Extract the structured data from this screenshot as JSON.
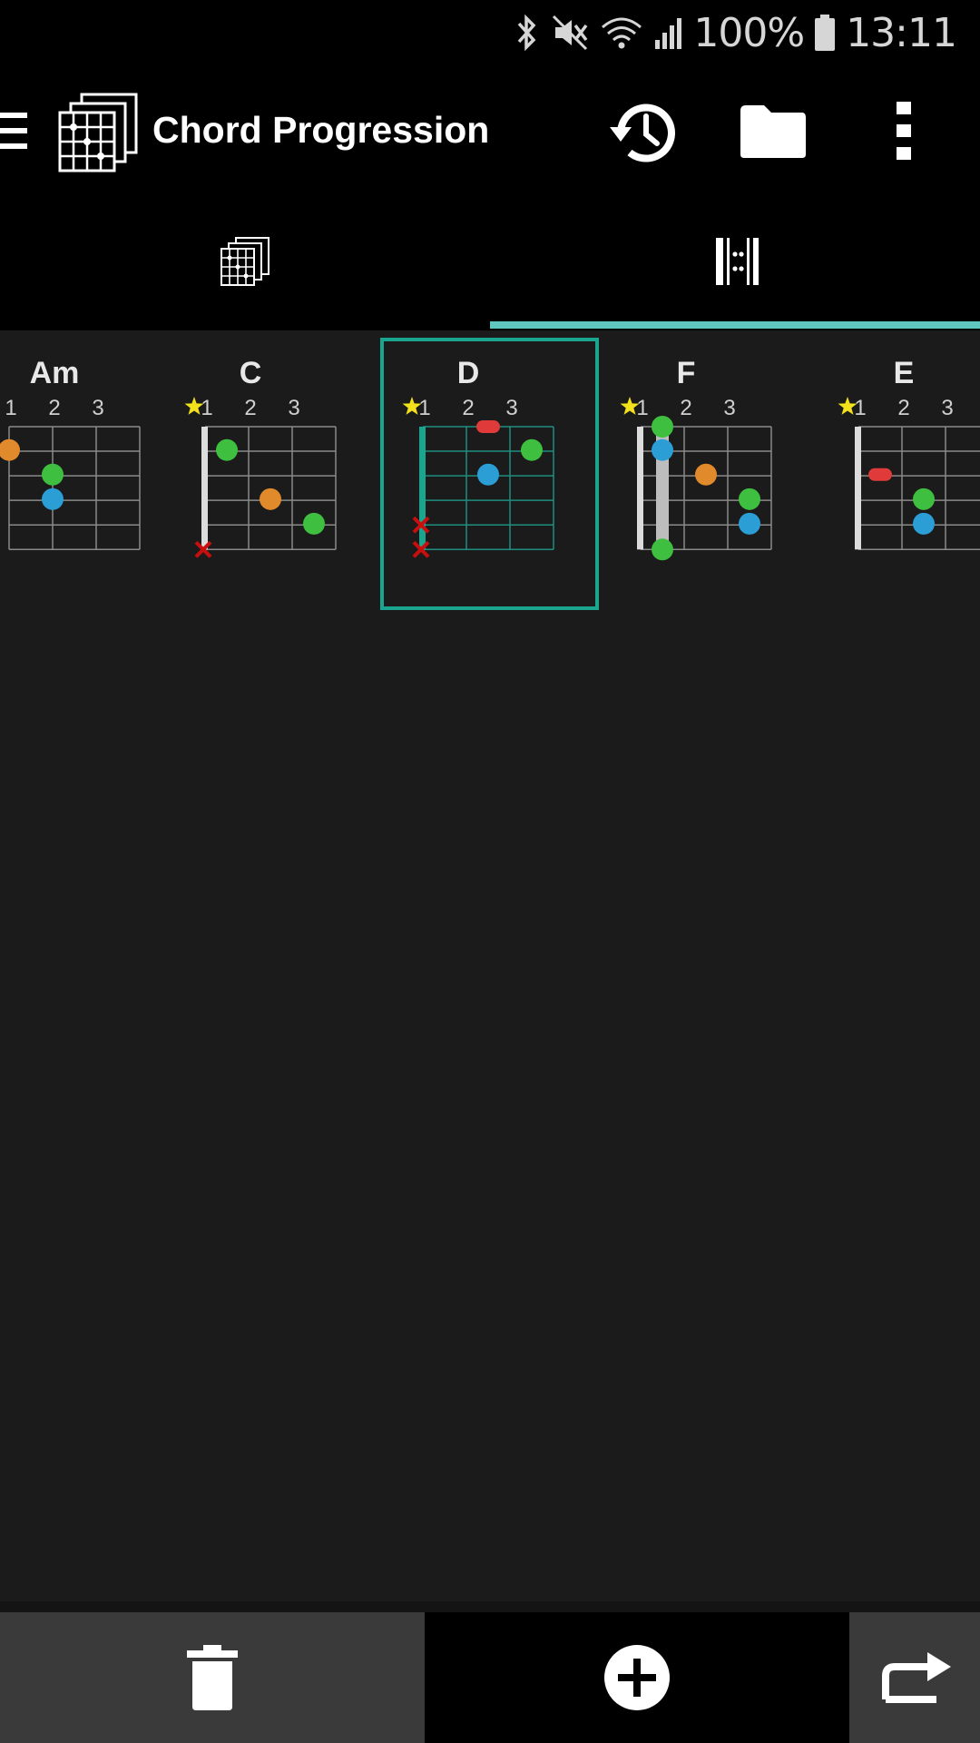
{
  "status_bar": {
    "battery": "100%",
    "time": "13:11",
    "icons": [
      "bluetooth-icon",
      "mute-icon",
      "wifi-icon",
      "signal-icon",
      "battery-icon"
    ]
  },
  "app_bar": {
    "title": "Chord Progression",
    "icons": [
      "menu-icon",
      "chord-sheets-logo-icon",
      "history-icon",
      "folder-icon",
      "more-vertical-icon"
    ]
  },
  "tabs": [
    {
      "name": "chord-list-tab",
      "icon": "chord-sheets-icon",
      "selected": false
    },
    {
      "name": "progression-tab",
      "icon": "repeat-bar-icon",
      "selected": true
    }
  ],
  "chords": [
    {
      "name": "Am",
      "fret_labels": [
        "1",
        "2",
        "3"
      ],
      "star": false,
      "selected": false
    },
    {
      "name": "C",
      "fret_labels": [
        "1",
        "2",
        "3"
      ],
      "star": true,
      "selected": false
    },
    {
      "name": "D",
      "fret_labels": [
        "1",
        "2",
        "3"
      ],
      "star": true,
      "selected": true
    },
    {
      "name": "F",
      "fret_labels": [
        "1",
        "2",
        "3"
      ],
      "star": true,
      "selected": false
    },
    {
      "name": "E",
      "fret_labels": [
        "1",
        "2",
        "3"
      ],
      "star": true,
      "selected": false
    }
  ],
  "colors": {
    "accent": "#5fc7bd",
    "selected_border": "#1aa58f",
    "green": "#3fbf3f",
    "blue": "#2b9ed6",
    "orange": "#e08a2c",
    "red": "#e03a3a",
    "star": "#f2e21b"
  },
  "bottom_bar": {
    "icons": [
      "trash-icon",
      "add-circle-icon",
      "repeat-icon"
    ]
  }
}
